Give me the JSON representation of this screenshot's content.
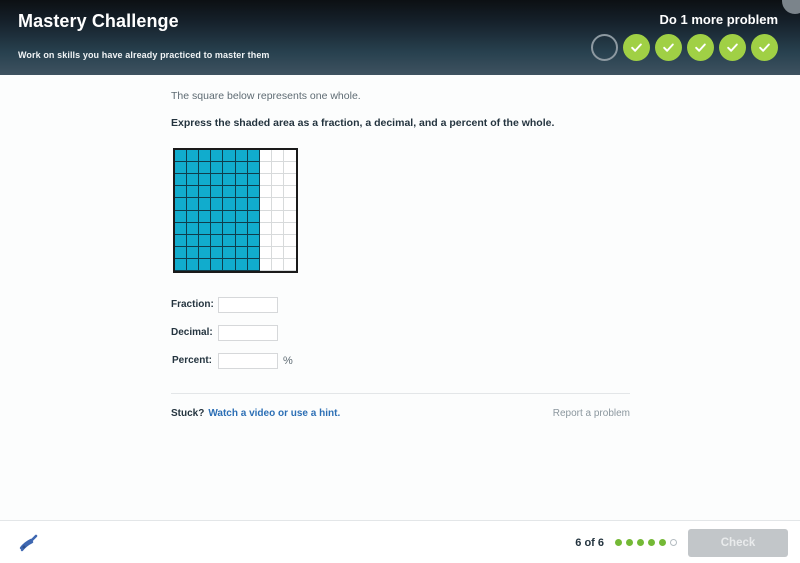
{
  "header": {
    "title": "Mastery Challenge",
    "subtitle": "Work on skills you have already practiced to master them",
    "cta": "Do 1 more problem",
    "streak": [
      {
        "state": "empty"
      },
      {
        "state": "done"
      },
      {
        "state": "done"
      },
      {
        "state": "done"
      },
      {
        "state": "done"
      },
      {
        "state": "done"
      }
    ],
    "colors": {
      "gradient_top": "#0c1013",
      "gradient_bottom": "#3e5260",
      "streak_done": "#a0d045",
      "streak_empty_border": "#8d99a1"
    }
  },
  "problem": {
    "prompt_line_1": "The square below represents one whole.",
    "prompt_line_2": "Express the shaded area as a fraction, a decimal, and a percent of the whole.",
    "grid": {
      "columns": 10,
      "rows": 10,
      "total_cells": 100,
      "shaded_cells": 70,
      "shaded_columns": 7,
      "shaded_fraction": "70/100",
      "shaded_decimal": "0.7",
      "shaded_percent": "70",
      "shaded_color": "#11accd",
      "unshaded_color": "#ffffff",
      "border_color": "#1a1a1a"
    },
    "fields": [
      {
        "label": "Fraction:",
        "value": "",
        "placeholder": "",
        "suffix": ""
      },
      {
        "label": "Decimal:",
        "value": "",
        "placeholder": "",
        "suffix": ""
      },
      {
        "label": "Percent:",
        "value": "",
        "placeholder": "",
        "suffix": "%"
      }
    ]
  },
  "help": {
    "stuck_label": "Stuck?",
    "hint_link": "Watch a video or use a hint.",
    "report_link": "Report a problem",
    "link_color": "#2c6fb5"
  },
  "footer": {
    "logo": "khan-academy-logo",
    "progress_text": "6 of 6",
    "dots": [
      "filled",
      "filled",
      "filled",
      "filled",
      "filled",
      "open"
    ],
    "check_label": "Check",
    "check_enabled": false,
    "dot_filled_color": "#74b936"
  }
}
